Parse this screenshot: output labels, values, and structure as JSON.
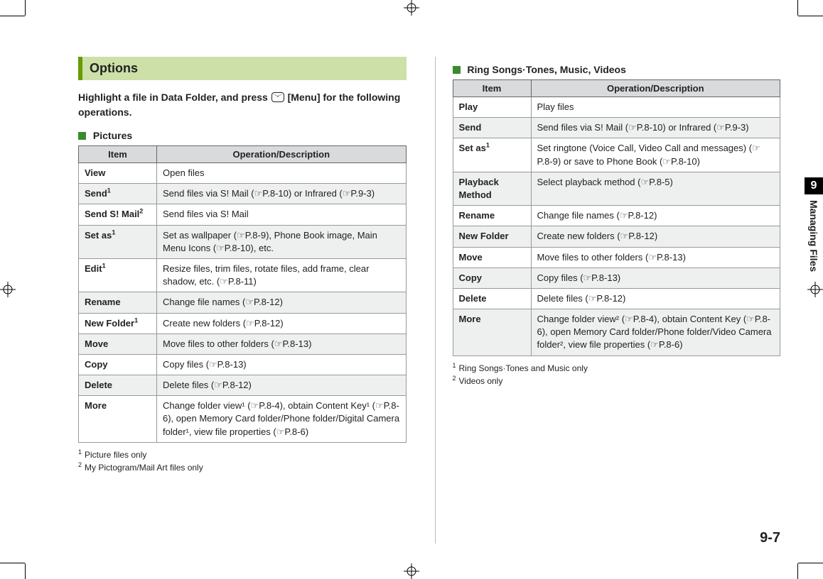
{
  "section_title": "Options",
  "intro_before": "Highlight a file in Data Folder, and press ",
  "intro_menu": "[Menu]",
  "intro_after": " for the following operations.",
  "pictures": {
    "heading": "Pictures",
    "th_item": "Item",
    "th_desc": "Operation/Description",
    "rows": [
      {
        "item": "View",
        "sup": "",
        "desc": "Open files"
      },
      {
        "item": "Send",
        "sup": "1",
        "desc": "Send files via S! Mail (☞P.8-10) or Infrared (☞P.9-3)"
      },
      {
        "item": "Send S! Mail",
        "sup": "2",
        "desc": "Send files via S! Mail"
      },
      {
        "item": "Set as",
        "sup": "1",
        "desc": "Set as wallpaper (☞P.8-9), Phone Book image, Main Menu Icons (☞P.8-10), etc."
      },
      {
        "item": "Edit",
        "sup": "1",
        "desc": "Resize files, trim files, rotate files, add frame, clear shadow, etc. (☞P.8-11)"
      },
      {
        "item": "Rename",
        "sup": "",
        "desc": "Change file names (☞P.8-12)"
      },
      {
        "item": "New Folder",
        "sup": "1",
        "desc": "Create new folders (☞P.8-12)"
      },
      {
        "item": "Move",
        "sup": "",
        "desc": "Move files to other folders (☞P.8-13)"
      },
      {
        "item": "Copy",
        "sup": "",
        "desc": "Copy files (☞P.8-13)"
      },
      {
        "item": "Delete",
        "sup": "",
        "desc": "Delete files (☞P.8-12)"
      },
      {
        "item": "More",
        "sup": "",
        "desc": "Change folder view¹ (☞P.8-4), obtain Content Key¹ (☞P.8-6), open Memory Card folder/Phone folder/Digital Camera folder¹, view file properties (☞P.8-6)"
      }
    ],
    "footnotes": [
      {
        "n": "1",
        "text": "Picture files only"
      },
      {
        "n": "2",
        "text": "My Pictogram/Mail Art files only"
      }
    ]
  },
  "ring": {
    "heading": "Ring Songs·Tones, Music, Videos",
    "th_item": "Item",
    "th_desc": "Operation/Description",
    "rows": [
      {
        "item": "Play",
        "sup": "",
        "desc": "Play files"
      },
      {
        "item": "Send",
        "sup": "",
        "desc": "Send files via S! Mail (☞P.8-10) or Infrared (☞P.9-3)"
      },
      {
        "item": "Set as",
        "sup": "1",
        "desc": "Set ringtone (Voice Call, Video Call and messages) (☞P.8-9) or save to Phone Book (☞P.8-10)"
      },
      {
        "item": "Playback Method",
        "sup": "",
        "desc": "Select playback method (☞P.8-5)"
      },
      {
        "item": "Rename",
        "sup": "",
        "desc": "Change file names (☞P.8-12)"
      },
      {
        "item": "New Folder",
        "sup": "",
        "desc": "Create new folders (☞P.8-12)"
      },
      {
        "item": "Move",
        "sup": "",
        "desc": "Move files to other folders (☞P.8-13)"
      },
      {
        "item": "Copy",
        "sup": "",
        "desc": "Copy files (☞P.8-13)"
      },
      {
        "item": "Delete",
        "sup": "",
        "desc": "Delete files (☞P.8-12)"
      },
      {
        "item": "More",
        "sup": "",
        "desc": "Change folder view² (☞P.8-4), obtain Content Key (☞P.8-6), open Memory Card folder/Phone folder/Video Camera folder², view file properties (☞P.8-6)"
      }
    ],
    "footnotes": [
      {
        "n": "1",
        "text": "Ring Songs·Tones and Music only"
      },
      {
        "n": "2",
        "text": "Videos only"
      }
    ]
  },
  "side_tab": {
    "num": "9",
    "label": "Managing Files"
  },
  "page_number": "9-7"
}
